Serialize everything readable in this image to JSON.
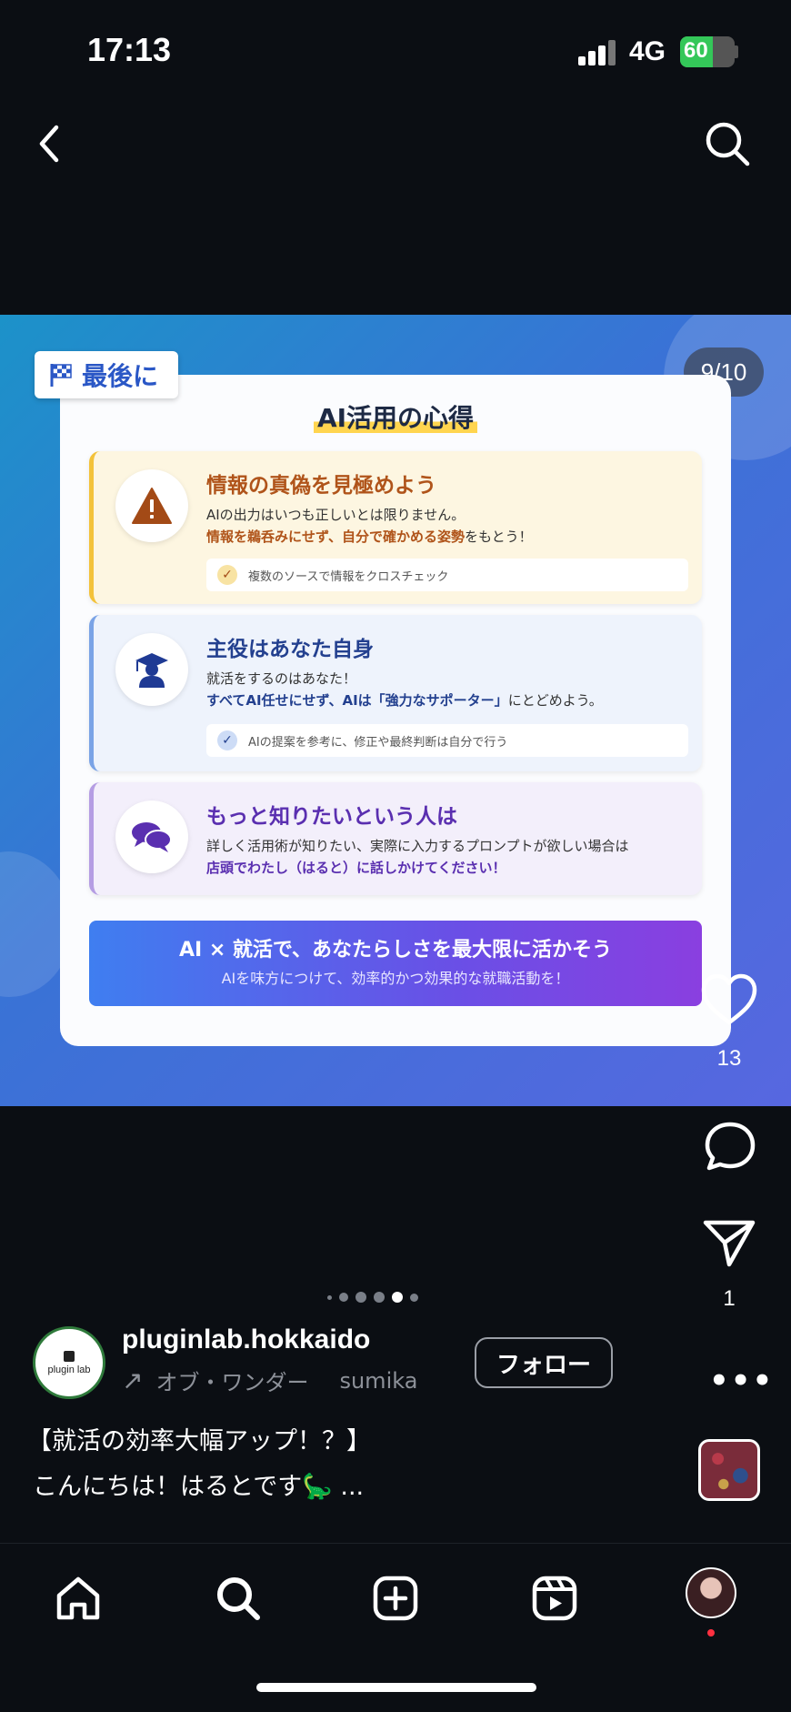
{
  "status_bar": {
    "time": "17:13",
    "network": "4G",
    "battery": "60",
    "battery_level": 0.6,
    "battery_color": "#34c759"
  },
  "header": {
    "back_icon": "chevron-left-icon",
    "search_icon": "search-icon"
  },
  "post": {
    "slide_counter": "9/10",
    "tag_label": "最後に",
    "tag_icon": "checkered-flag-icon",
    "card_title": "AI活用の心得",
    "items": [
      {
        "icon": "warning-icon",
        "title": "情報の真偽を見極めよう",
        "line1": "AIの出力はいつも正しいとは限りません。",
        "line2_emphasis": "情報を鵜呑みにせず、自分で確かめる姿勢",
        "line2_rest": "をもとう！",
        "check": "複数のソースで情報をクロスチェック",
        "accent": "#f3c23a"
      },
      {
        "icon": "graduate-icon",
        "title": "主役はあなた自身",
        "line1": "就活をするのはあなた！",
        "line2_emphasis": "すべてAI任せにせず、AIは「強力なサポーター」",
        "line2_rest": "にとどめよう。",
        "check": "AIの提案を参考に、修正や最終判断は自分で行う",
        "accent": "#7aa3e6"
      },
      {
        "icon": "chat-bubbles-icon",
        "title": "もっと知りたいという人は",
        "line1": "詳しく活用術が知りたい、実際に入力するプロンプトが欲しい場合は",
        "line2_emphasis": "店頭でわたし（はると）に話しかけてください！",
        "accent": "#b59de3"
      }
    ],
    "banner_title": "AI × 就活で、あなたらしさを最大限に活かそう",
    "banner_subtitle": "AIを味方につけて、効率的かつ効果的な就職活動を！"
  },
  "actions": {
    "like_count": "13",
    "share_count": "1"
  },
  "carousel": {
    "total_dots_visible": 6,
    "active_dot": 4
  },
  "author": {
    "username": "pluginlab.hokkaido",
    "avatar_text": "plugin lab",
    "music_title": "オブ・ワンダー",
    "music_artist": "sumika",
    "follow_label": "フォロー",
    "more_label": "•••"
  },
  "caption": {
    "line1": "【就活の効率大幅アップ！？】",
    "line2": "こんにちは！はるとです🦕 ..."
  }
}
